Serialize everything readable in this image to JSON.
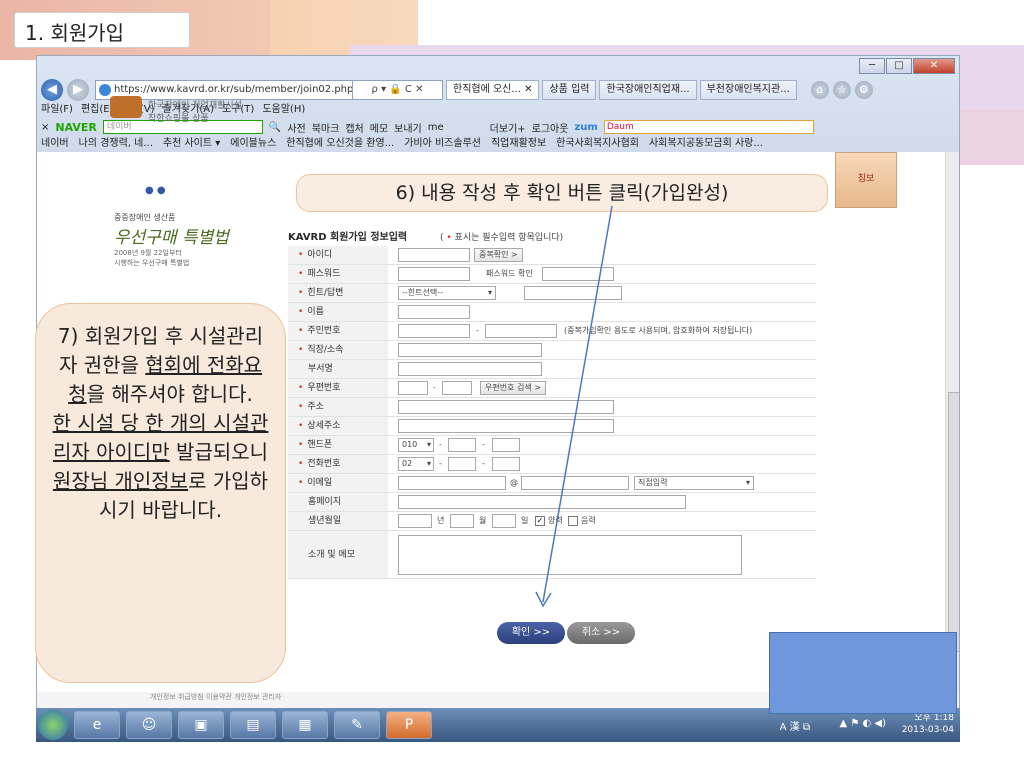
{
  "slide": {
    "title": "1. 회원가입"
  },
  "browser": {
    "url": "https://www.kavrd.or.kr/sub/member/join02.php",
    "url_controls": "ρ ▾ 🔒 C ✕",
    "tabs": [
      {
        "label": "한직협에 오신... ✕"
      },
      {
        "label": "상품 입력"
      },
      {
        "label": "한국장애인직업재..."
      },
      {
        "label": "부천장애인복지관..."
      }
    ],
    "window_buttons": [
      "─",
      "□",
      "✕"
    ],
    "menu": [
      "파일(F)",
      "편집(E)",
      "보기(V)",
      "즐겨찾기(A)",
      "도구(T)",
      "도움말(H)"
    ],
    "naver_bar": {
      "close": "×",
      "logo": "NAVER",
      "search_placeholder": "네이버",
      "items": [
        "사전",
        "북마크",
        "캡처",
        "메모",
        "보내기",
        "me"
      ],
      "more": "더보기+",
      "login": "로그아웃",
      "zum": "zum",
      "daum": "Daum"
    },
    "favorites": [
      "네이버",
      "나의 경쟁력, 네...",
      "추천 사이트 ▾",
      "에이블뉴스",
      "한직협에 오신것을 환영...",
      "가비아 비즈솔루션",
      "직업재활정보",
      "한국사회복지사협회",
      "사회복지공동모금회 사랑..."
    ]
  },
  "page": {
    "banner_text": "한국장애인 직업재활시설 착한쇼핑몰 상품",
    "promo_small": "중증장애인 생산품",
    "promo_big": "우선구매 특별법",
    "promo_sub1": "2008년 9월 22일부터",
    "promo_sub2": "시행하는 우선구매 특별법",
    "product_label": "침보",
    "form_title": "KAVRD 회원가입 정보입력",
    "form_note_prefix": "( ",
    "form_note_dot": "•",
    "form_note_text": " 표시는 필수입력 항목입니다)",
    "fields": {
      "id": "아이디",
      "id_check": "중복확인 >",
      "password": "패스워드",
      "password_confirm": "패스워드 확인",
      "hint": "힌트/답변",
      "hint_select": "--힌트선택--",
      "name": "이름",
      "ssn": "주민번호",
      "ssn_dash": "-",
      "ssn_note": "(중복가입확인 용도로 사용되며, 암호화하여 저장됩니다)",
      "workplace": "직장/소속",
      "department": "부서명",
      "zipcode": "우편번호",
      "zip_dash": "-",
      "zip_search": "우편번호 검색 >",
      "address": "주소",
      "address_detail": "상세주소",
      "mobile": "핸드폰",
      "mobile_prefix": "010",
      "phone": "전화번호",
      "phone_prefix": "02",
      "dash": "-",
      "email": "이메일",
      "email_at": "@",
      "email_select": "직접입력",
      "homepage": "홈페이지",
      "birthday": "생년월일",
      "year": "년",
      "month": "월",
      "day": "일",
      "solar": "양력",
      "lunar": "음력",
      "memo": "소개 및 메모"
    },
    "confirm_label": "확인 >>",
    "cancel_label": "취소 >>",
    "footer": "개인정보 취급방침      이용약관      개인정보 관리자"
  },
  "taskbar": {
    "time": "오후 1:18",
    "date": "2013-03-04",
    "ime": "A 漢 ⧉"
  },
  "callouts": {
    "step6": "6) 내용 작성 후 확인 버튼 클릭(가입완성)",
    "step7_a": "7) 회원가입 후 시설관리자 권한을 ",
    "step7_u1": "협회에 전화요청",
    "step7_b": "을 해주셔야 합니다.",
    "step7_u2": "한 시설 당 한 개의 시설관리자 아이디만",
    "step7_c": " 발급되오니 ",
    "step7_u3": "원장님 개인정보",
    "step7_d": "로 가입하시기 바랍니다."
  }
}
